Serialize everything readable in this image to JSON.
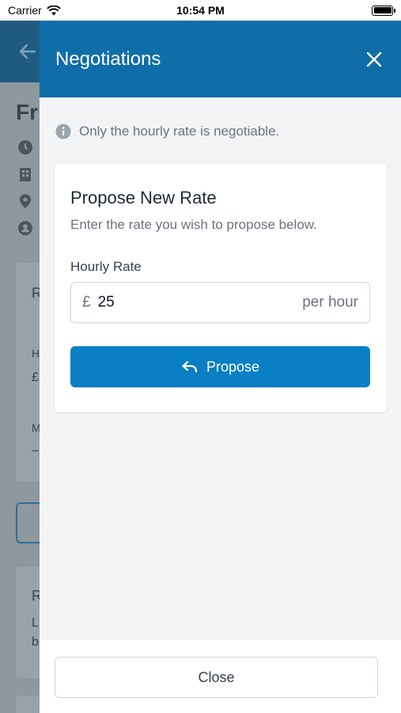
{
  "status_bar": {
    "carrier": "Carrier",
    "time": "10:54 PM"
  },
  "background": {
    "title_fragment": "Fr",
    "card_headers": [
      "R",
      "R"
    ],
    "card_lines": [
      "H",
      "£",
      "M",
      "–",
      "L",
      "b"
    ]
  },
  "modal": {
    "title": "Negotiations",
    "info": "Only the hourly rate is negotiable.",
    "card": {
      "title": "Propose New Rate",
      "subtitle": "Enter the rate you wish to propose below.",
      "field_label": "Hourly Rate",
      "currency": "£",
      "value": "25",
      "unit": "per hour",
      "button_label": "Propose"
    },
    "close_label": "Close"
  },
  "colors": {
    "header": "#0f6ea8",
    "button": "#0a7fc4",
    "panel_bg": "#f3f4f6"
  }
}
